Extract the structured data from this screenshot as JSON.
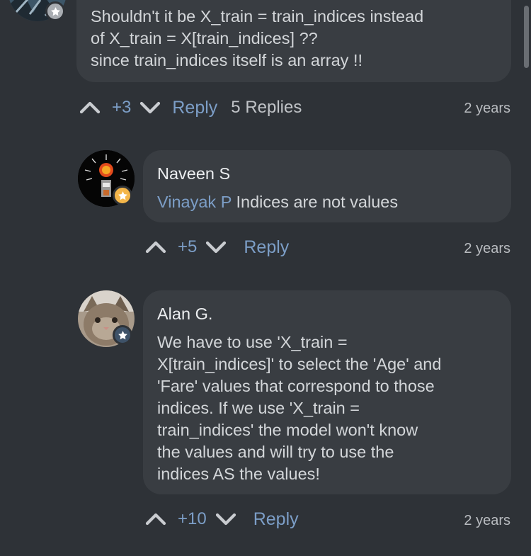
{
  "thread": {
    "top_comment": {
      "text": "Shouldn't it be X_train = train_indices  instead\nof X_train = X[train_indices] ??\nsince train_indices itself is an array !!",
      "votes": "+3",
      "reply_label": "Reply",
      "replies_count": "5 Replies",
      "time": "2 years"
    },
    "replies": [
      {
        "author": "Naveen S",
        "mention": "Vinayak P",
        "text": " Indices are not values",
        "votes": "+5",
        "reply_label": "Reply",
        "time": "2 years"
      },
      {
        "author": "Alan G.",
        "text": "We have to use 'X_train =\nX[train_indices]' to select the 'Age' and\n'Fare' values that correspond to those\nindices. If we use 'X_train =\ntrain_indices' the model won't know\nthe values and will try to use the\nindices AS the values!",
        "votes": "+10",
        "reply_label": "Reply",
        "time": "2 years"
      }
    ]
  },
  "colors": {
    "background": "#2e3237",
    "bubble": "#393d42",
    "accent": "#7c9ec7",
    "badge_gold": "#f4b64a"
  },
  "icons": {
    "upvote": "chevron-up-icon",
    "downvote": "chevron-down-icon",
    "badge": "star-icon"
  }
}
